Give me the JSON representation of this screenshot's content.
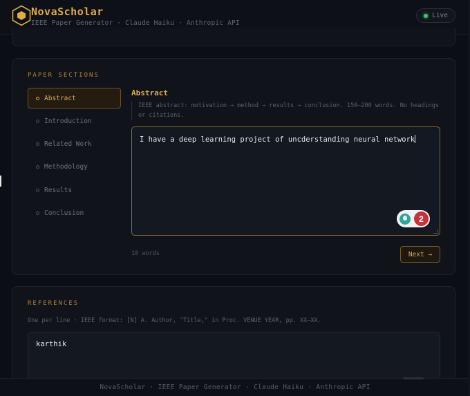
{
  "app": {
    "name": "NovaScholar",
    "subtitle": "IEEE Paper Generator · Claude Haiku · Anthropic API",
    "status": "Live"
  },
  "sections_card": {
    "title": "PAPER SECTIONS",
    "items": [
      {
        "label": "Abstract",
        "active": true
      },
      {
        "label": "Introduction",
        "active": false
      },
      {
        "label": "Related Work",
        "active": false
      },
      {
        "label": "Methodology",
        "active": false
      },
      {
        "label": "Results",
        "active": false
      },
      {
        "label": "Conclusion",
        "active": false
      }
    ],
    "current": {
      "title": "Abstract",
      "hint": "IEEE abstract: motivation → method → results → conclusion. 150–200 words. No headings or citations.",
      "text": "I have a deep learning project of uncderstanding neural network",
      "word_count": "10 words",
      "extension_badge_count": "2"
    },
    "next_label": "Next →"
  },
  "references_card": {
    "title": "REFERENCES",
    "hint": "One per line · IEEE format: [N] A. Author, \"Title,\" in Proc. VENUE YEAR, pp. XX–XX.",
    "text": "karthik"
  },
  "footer": {
    "text": "NovaScholar · IEEE Paper Generator · Claude Haiku · Anthropic API"
  },
  "colors": {
    "accent": "#e0a94a",
    "background": "#0b0e14",
    "card": "#10131a",
    "live": "#3ec46d",
    "badge": "#c9303e"
  }
}
